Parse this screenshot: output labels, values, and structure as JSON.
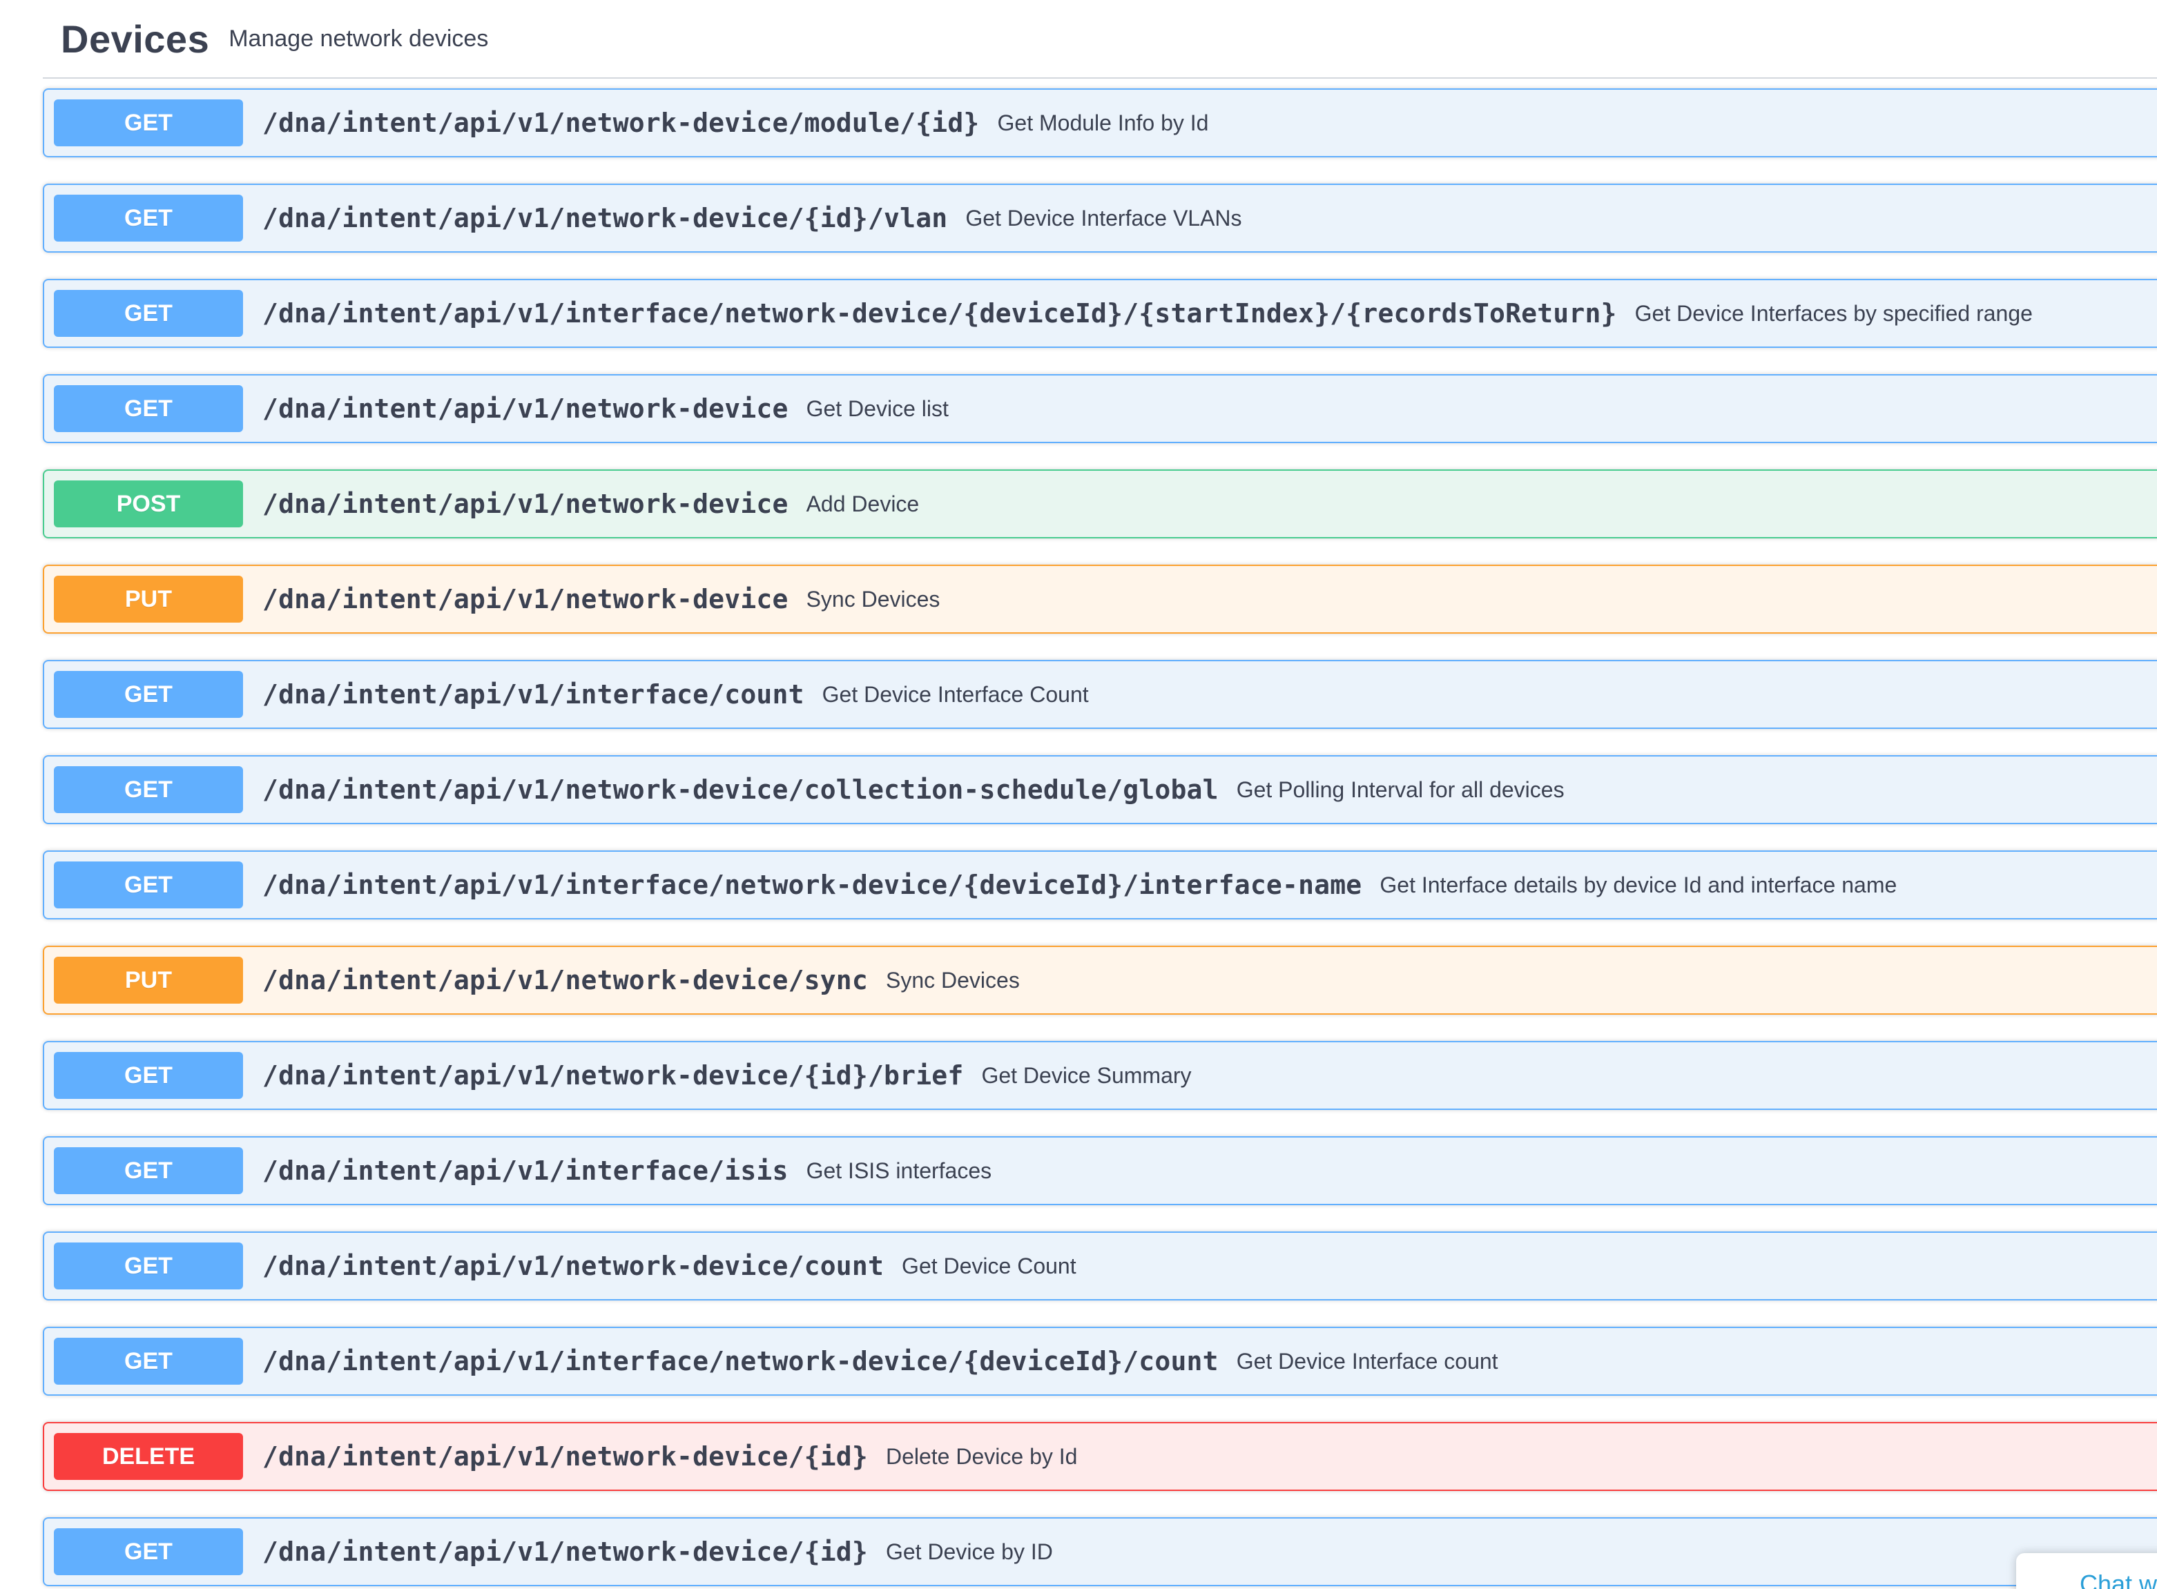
{
  "header": {
    "title": "Devices",
    "description": "Manage network devices"
  },
  "operations": [
    {
      "method": "GET",
      "path": "/dna/intent/api/v1/network-device/module/{id}",
      "summary": "Get Module Info by Id"
    },
    {
      "method": "GET",
      "path": "/dna/intent/api/v1/network-device/{id}/vlan",
      "summary": "Get Device Interface VLANs"
    },
    {
      "method": "GET",
      "path": "/dna/intent/api/v1/interface/network-device/{deviceId}/{startIndex}/{recordsToReturn}",
      "summary": "Get Device Interfaces by specified range"
    },
    {
      "method": "GET",
      "path": "/dna/intent/api/v1/network-device",
      "summary": "Get Device list"
    },
    {
      "method": "POST",
      "path": "/dna/intent/api/v1/network-device",
      "summary": "Add Device"
    },
    {
      "method": "PUT",
      "path": "/dna/intent/api/v1/network-device",
      "summary": "Sync Devices"
    },
    {
      "method": "GET",
      "path": "/dna/intent/api/v1/interface/count",
      "summary": "Get Device Interface Count"
    },
    {
      "method": "GET",
      "path": "/dna/intent/api/v1/network-device/collection-schedule/global",
      "summary": "Get Polling Interval for all devices"
    },
    {
      "method": "GET",
      "path": "/dna/intent/api/v1/interface/network-device/{deviceId}/interface-name",
      "summary": "Get Interface details by device Id and interface name"
    },
    {
      "method": "PUT",
      "path": "/dna/intent/api/v1/network-device/sync",
      "summary": "Sync Devices"
    },
    {
      "method": "GET",
      "path": "/dna/intent/api/v1/network-device/{id}/brief",
      "summary": "Get Device Summary"
    },
    {
      "method": "GET",
      "path": "/dna/intent/api/v1/interface/isis",
      "summary": "Get ISIS interfaces"
    },
    {
      "method": "GET",
      "path": "/dna/intent/api/v1/network-device/count",
      "summary": "Get Device Count"
    },
    {
      "method": "GET",
      "path": "/dna/intent/api/v1/interface/network-device/{deviceId}/count",
      "summary": "Get Device Interface count"
    },
    {
      "method": "DELETE",
      "path": "/dna/intent/api/v1/network-device/{id}",
      "summary": "Delete Device by Id"
    },
    {
      "method": "GET",
      "path": "/dna/intent/api/v1/network-device/{id}",
      "summary": "Get Device by ID"
    }
  ],
  "chat": {
    "label": "Chat w"
  },
  "colors": {
    "get": "#61affe",
    "post": "#49cc90",
    "put": "#fca130",
    "delete": "#f93e3e",
    "text": "#3b4151"
  }
}
